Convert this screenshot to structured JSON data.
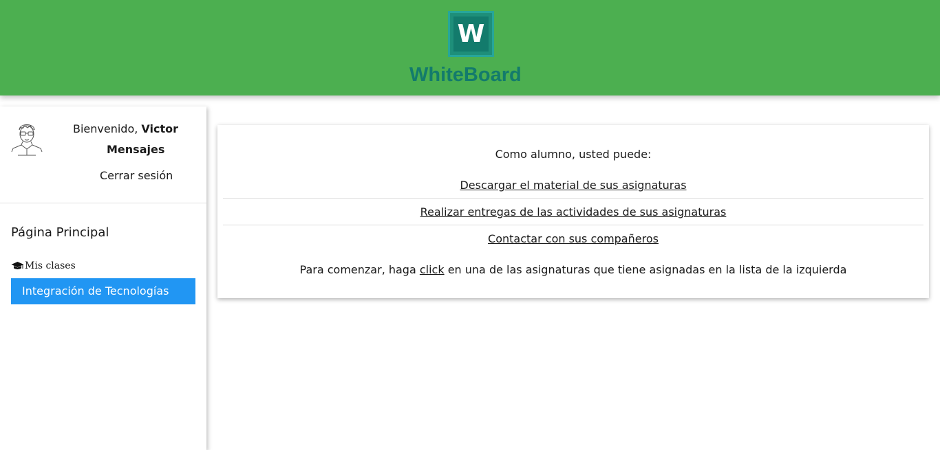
{
  "app": {
    "logo_letter": "W",
    "logo_text": "WhiteBoard",
    "brand_color": "#4caf50",
    "logo_color": "#137b6c"
  },
  "sidebar": {
    "welcome_prefix": "Bienvenido, ",
    "user_name": "Victor",
    "messages": "Mensajes",
    "logout": "Cerrar sesión",
    "home": "Página Principal",
    "my_classes_icon": "graduation-cap-icon",
    "my_classes": "Mis clases",
    "classes": [
      {
        "label": "Integración de Tecnologías",
        "active": true,
        "color": "#2196f3"
      }
    ]
  },
  "main": {
    "intro": "Como alumno, usted puede:",
    "options": [
      "Descargar el material de sus asignaturas",
      "Realizar entregas de las actividades de sus asignaturas",
      "Contactar con sus compañeros"
    ],
    "footer_before": "Para comenzar, haga ",
    "footer_link": "click",
    "footer_after": " en una de las asignaturas que tiene asignadas en la lista de la izquierda"
  }
}
